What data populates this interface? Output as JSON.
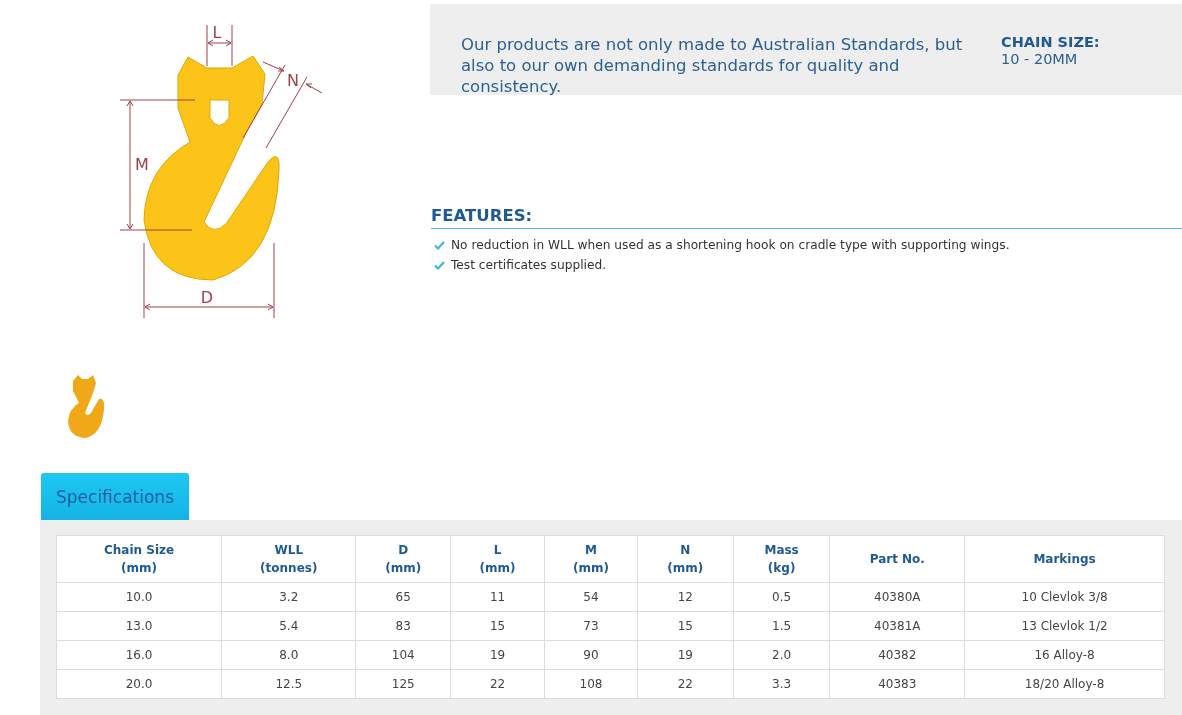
{
  "diagram": {
    "labels": [
      {
        "kind": "L",
        "text": "L"
      },
      {
        "kind": "N",
        "text": "N"
      },
      {
        "kind": "M",
        "text": "M"
      },
      {
        "kind": "D",
        "text": "D"
      }
    ]
  },
  "intro": {
    "text": "Our products are not only made to Australian Standards, but also to our own demanding standards for quality and consistency.",
    "chain_size_label": "CHAIN SIZE:",
    "chain_size_value": "10 - 20MM"
  },
  "features": {
    "heading": "FEATURES:",
    "items": [
      "No reduction in WLL when used as a shortening hook on cradle type with supporting wings.",
      "Test certificates supplied."
    ]
  },
  "tabs": [
    {
      "label": "Specifications",
      "selected": true
    }
  ],
  "table": {
    "columns": [
      {
        "label": "Chain Size",
        "unit": "(mm)"
      },
      {
        "label": "WLL",
        "unit": "(tonnes)"
      },
      {
        "label": "D",
        "unit": "(mm)"
      },
      {
        "label": "L",
        "unit": "(mm)"
      },
      {
        "label": "M",
        "unit": "(mm)"
      },
      {
        "label": "N",
        "unit": "(mm)"
      },
      {
        "label": "Mass",
        "unit": "(kg)"
      },
      {
        "label": "Part No."
      },
      {
        "label": "Markings"
      }
    ],
    "rows": [
      [
        "10.0",
        "3.2",
        "65",
        "11",
        "54",
        "12",
        "0.5",
        "40380A",
        "10 Clevlok 3/8"
      ],
      [
        "13.0",
        "5.4",
        "83",
        "15",
        "73",
        "15",
        "1.5",
        "40381A",
        "13 Clevlok 1/2"
      ],
      [
        "16.0",
        "8.0",
        "104",
        "19",
        "90",
        "19",
        "2.0",
        "40382",
        "16 Alloy-8"
      ],
      [
        "20.0",
        "12.5",
        "125",
        "22",
        "108",
        "22",
        "3.3",
        "40383",
        "18/20 Alloy-8"
      ]
    ]
  }
}
